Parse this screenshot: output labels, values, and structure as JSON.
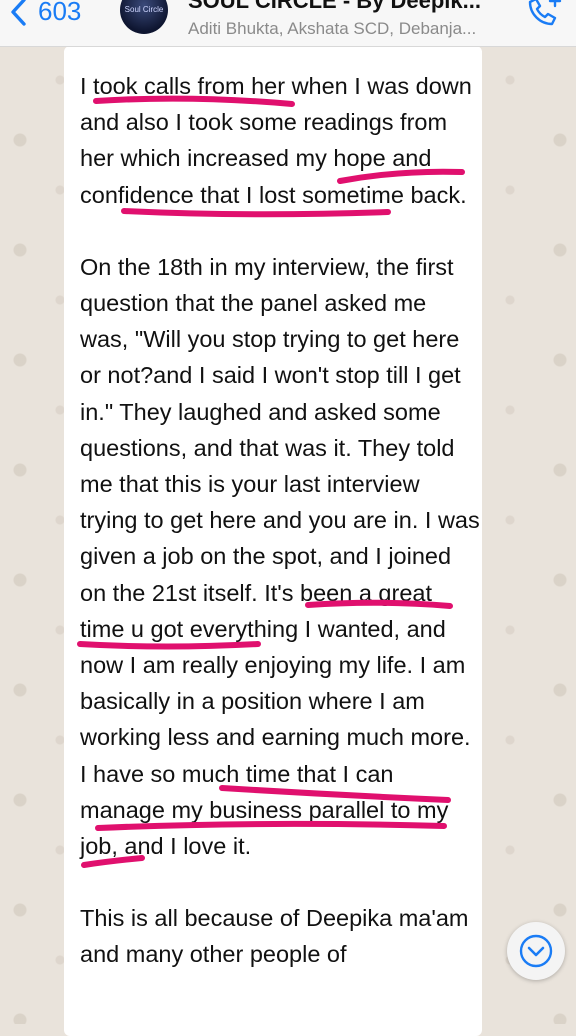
{
  "header": {
    "back_count": "603",
    "avatar_text": "Soul Circle",
    "chat_title": "SOUL CIRCLE - By Deepik...",
    "members": "Aditi Bhukta, Akshata SCD, Debanja..."
  },
  "message": {
    "paragraphs": [
      "I took calls from her when I was down and also I took some readings from her which increased my hope and confidence that I lost sometime back.",
      "On the 18th in my interview, the first question that the panel asked me was, \"Will you stop trying to get here or not?and I said I won't stop till I get in.\" They laughed and asked some questions, and that was it. They told me that this is your last interview trying to get here and you are in. I was given a job on the spot, and I joined on the 21st itself. It's been a great time u got everything I wanted, and now I am really enjoying my life. I am basically in a position where I am working less and earning much more. I have so much time that I can manage my business parallel to my job, and I love it.",
      "This is all because of Deepika ma'am and many other people of"
    ]
  },
  "highlight_color": "#e0106e"
}
